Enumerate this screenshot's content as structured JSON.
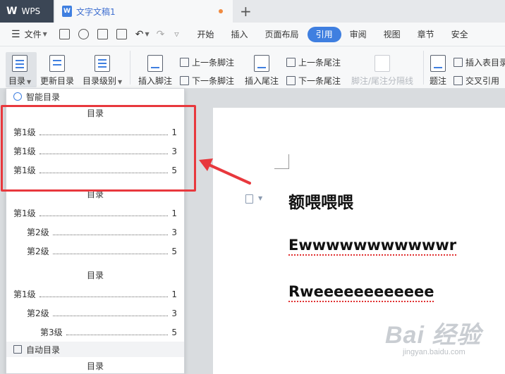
{
  "titlebar": {
    "app_name": "WPS",
    "doc_tab_name": "文字文稿1",
    "new_tab_symbol": "+"
  },
  "menubar": {
    "file_label": "文件",
    "tabs": [
      "开始",
      "插入",
      "页面布局",
      "引用",
      "审阅",
      "视图",
      "章节",
      "安全"
    ],
    "active_tab": "引用"
  },
  "ribbon": {
    "toc": "目录",
    "update_toc": "更新目录",
    "toc_level": "目录级别",
    "insert_footnote": "插入脚注",
    "prev_footnote": "上一条脚注",
    "next_footnote": "下一条脚注",
    "insert_endnote": "插入尾注",
    "prev_endnote": "上一条尾注",
    "next_endnote": "下一条尾注",
    "separator_line": "脚注/尾注分隔线",
    "caption": "题注",
    "insert_table_toc": "插入表目录",
    "cross_ref": "交叉引用"
  },
  "toc_panel": {
    "smart_toc": "智能目录",
    "auto_toc": "自动目录",
    "blocks": [
      {
        "title": "目录",
        "rows": [
          {
            "label": "第1级",
            "page": "1",
            "indent": 0
          },
          {
            "label": "第1级",
            "page": "3",
            "indent": 0
          },
          {
            "label": "第1级",
            "page": "5",
            "indent": 0
          }
        ]
      },
      {
        "title": "目录",
        "rows": [
          {
            "label": "第1级",
            "page": "1",
            "indent": 0
          },
          {
            "label": "第2级",
            "page": "3",
            "indent": 1
          },
          {
            "label": "第2级",
            "page": "5",
            "indent": 1
          }
        ]
      },
      {
        "title": "目录",
        "rows": [
          {
            "label": "第1级",
            "page": "1",
            "indent": 0
          },
          {
            "label": "第2级",
            "page": "3",
            "indent": 1
          },
          {
            "label": "第3级",
            "page": "5",
            "indent": 2
          }
        ]
      }
    ],
    "bottom_title": "目录"
  },
  "document": {
    "lines": [
      "额喂喂喂",
      "Ewwwwwwwwwwwr",
      "Rweeeeeeeeeeee"
    ]
  },
  "watermark": {
    "text": "Bai 经验",
    "url": "jingyan.baidu.com"
  },
  "colors": {
    "accent": "#3f7fe0",
    "highlight": "#e8383d"
  }
}
